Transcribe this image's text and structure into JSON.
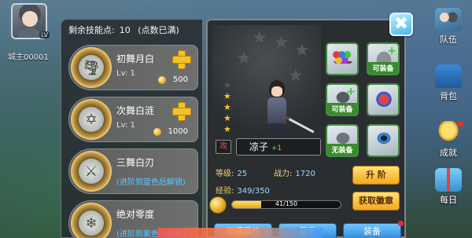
{
  "player": {
    "name": "城主00001",
    "level": "LV"
  },
  "skills_panel": {
    "points_label": "剩余技能点:",
    "points_value": "10",
    "points_note": "(点数已满)",
    "items": [
      {
        "name": "初舞月白",
        "level": "Lv: 1",
        "cost": "500",
        "icon": "tornado-icon"
      },
      {
        "name": "次舞白涟",
        "level": "Lv: 1",
        "cost": "1000",
        "icon": "hexagram-icon"
      },
      {
        "name": "三舞白刃",
        "lock": "(进阶到蓝色后解锁)",
        "icon": "slash-icon"
      },
      {
        "name": "绝对零度",
        "lock": "(进阶到紫色后解锁)",
        "icon": "frost-icon"
      }
    ]
  },
  "character": {
    "attack_tag": "攻",
    "name": "凉子",
    "name_plus": "+1",
    "level_label": "等级:",
    "level_value": "25",
    "power_label": "战力:",
    "power_value": "1720",
    "exp_label": "经验:",
    "exp_value": "349/350",
    "medal_bar_text": "41/150",
    "medal_bar_fraction": 0.27,
    "upgrade_button": "升 阶",
    "get_medal_button": "获取徽章",
    "equipment": [
      {
        "name": "orb-rack-icon",
        "tag": ""
      },
      {
        "name": "helmet-icon",
        "tag": "可装备"
      },
      {
        "name": "gauntlet-icon",
        "tag": "可装备"
      },
      {
        "name": "potion-icon",
        "tag": ""
      },
      {
        "name": "armor-icon",
        "tag": "无装备"
      },
      {
        "name": "bracelet-icon",
        "tag": ""
      }
    ],
    "tabs": [
      "详细属性",
      "显示",
      "装备"
    ],
    "stars_lit": 4
  },
  "side_menu": [
    {
      "label": "队伍",
      "icon": "team-icon"
    },
    {
      "label": "背包",
      "icon": "backpack-icon"
    },
    {
      "label": "成就",
      "icon": "trophy-icon"
    },
    {
      "label": "每日",
      "icon": "gift-icon"
    }
  ],
  "colors": {
    "gold": "#f3c12a",
    "equip_green": "#3b8a2e",
    "tab_blue": "#2d88d8",
    "lock_blue": "#5cc8ff"
  }
}
